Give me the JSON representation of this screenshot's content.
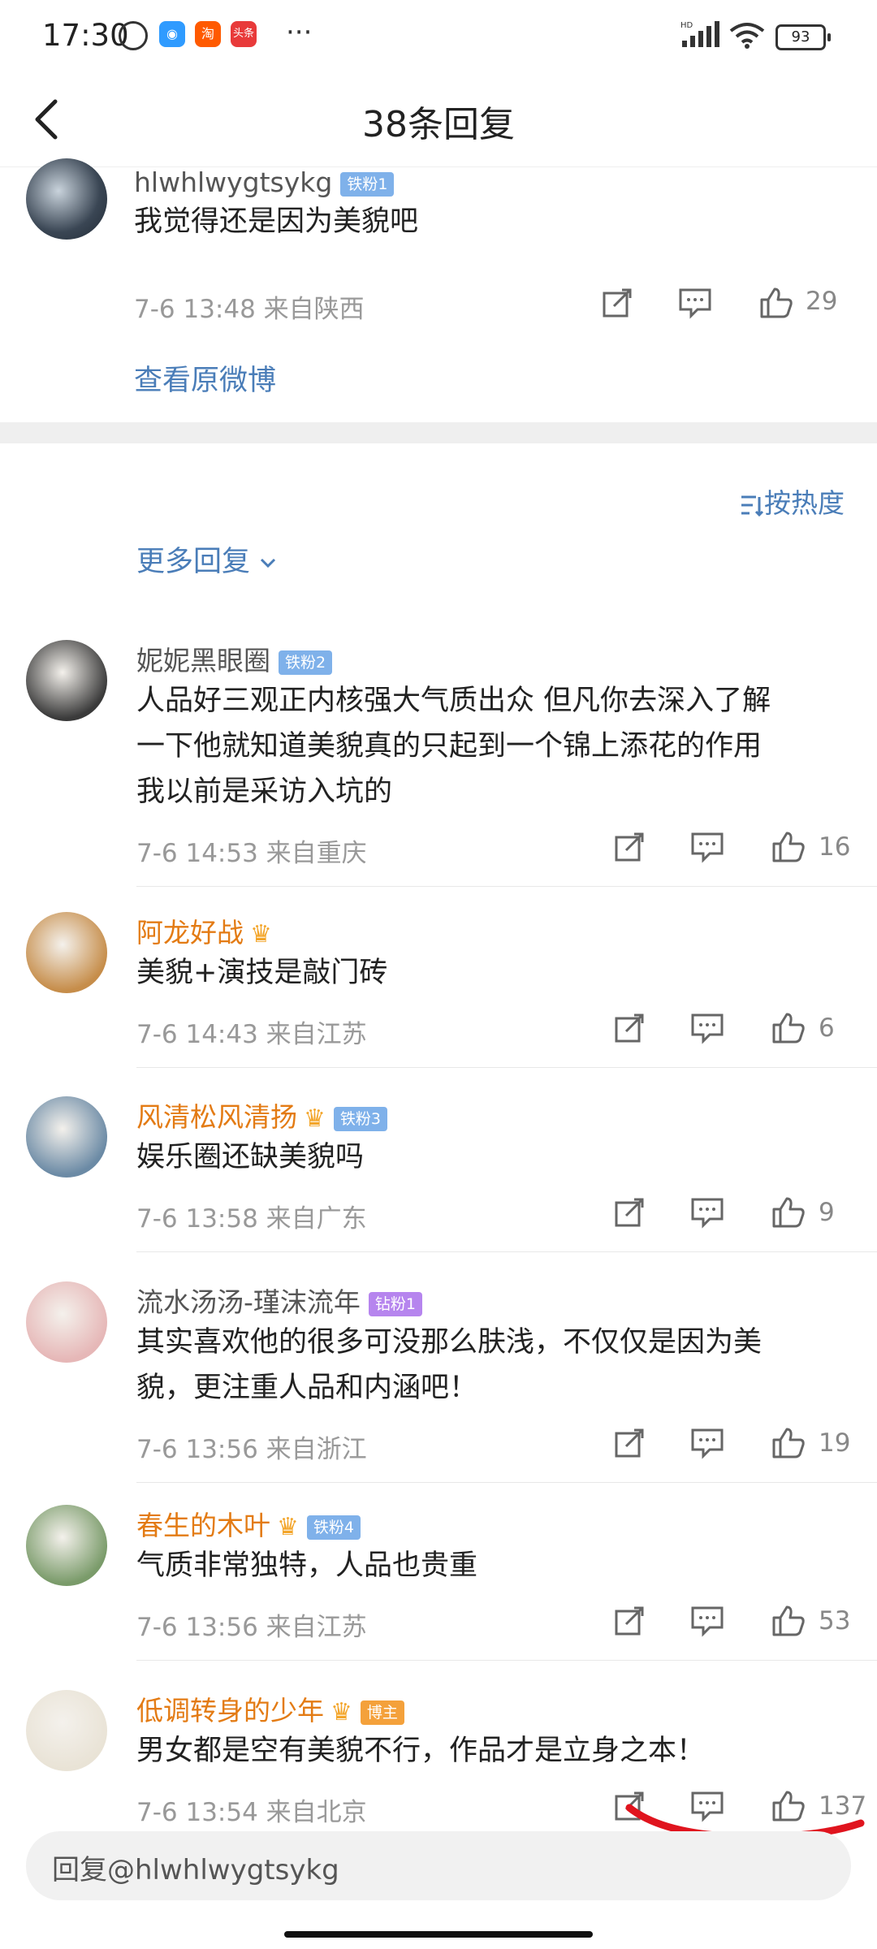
{
  "status_bar": {
    "time": "17:30",
    "app_icons": [
      "alarm-icon",
      "app-icon",
      "淘",
      "头条"
    ],
    "more": "···",
    "battery": "93",
    "signal": "HD"
  },
  "header": {
    "title": "38条回复"
  },
  "root_comment": {
    "user": "hlwhlwygtsykg",
    "badge": "铁粉1",
    "text": "我觉得还是因为美貌吧",
    "meta": "7-6 13:48  来自陕西",
    "likes": "29",
    "view_original": "查看原微博"
  },
  "sort_label": "按热度",
  "more_replies": "更多回复",
  "comments": [
    {
      "user": "妮妮黑眼圈",
      "badge": "铁粉2",
      "badge_style": "blue",
      "text_lines": [
        "人品好三观正内核强大气质出众 但凡你去深入了解",
        "一下他就知道美貌真的只起到一个锦上添花的作用",
        "我以前是采访入坑的"
      ],
      "meta": "7-6 14:53  来自重庆",
      "likes": "16"
    },
    {
      "user": "阿龙好战",
      "badge": "",
      "badge_style": "crown",
      "text_lines": [
        "美貌+演技是敲门砖"
      ],
      "meta": "7-6 14:43  来自江苏",
      "likes": "6"
    },
    {
      "user": "风清松风清扬",
      "badge": "铁粉3",
      "badge_style": "blue",
      "text_lines": [
        "娱乐圈还缺美貌吗"
      ],
      "meta": "7-6 13:58  来自广东",
      "likes": "9"
    },
    {
      "user": "流水汤汤-瑾沫流年",
      "badge": "钻粉1",
      "badge_style": "purple",
      "text_lines": [
        "其实喜欢他的很多可没那么肤浅，不仅仅是因为美",
        "貌，更注重人品和内涵吧！"
      ],
      "meta": "7-6 13:56  来自浙江",
      "likes": "19"
    },
    {
      "user": "春生的木叶",
      "badge": "铁粉4",
      "badge_style": "blue",
      "text_lines": [
        "气质非常独特，人品也贵重"
      ],
      "meta": "7-6 13:56  来自江苏",
      "likes": "53"
    },
    {
      "user": "低调转身的少年",
      "badge": "博主",
      "badge_style": "orange",
      "text_lines": [
        "男女都是空有美貌不行，作品才是立身之本！"
      ],
      "meta": "7-6 13:54  来自北京",
      "likes": "137"
    }
  ],
  "reply_input": {
    "placeholder": "回复@hlwhlwygtsykg"
  },
  "colors": {
    "link": "#4a7db8",
    "vip_name": "#e37b14",
    "annotation": "#e0141e"
  }
}
